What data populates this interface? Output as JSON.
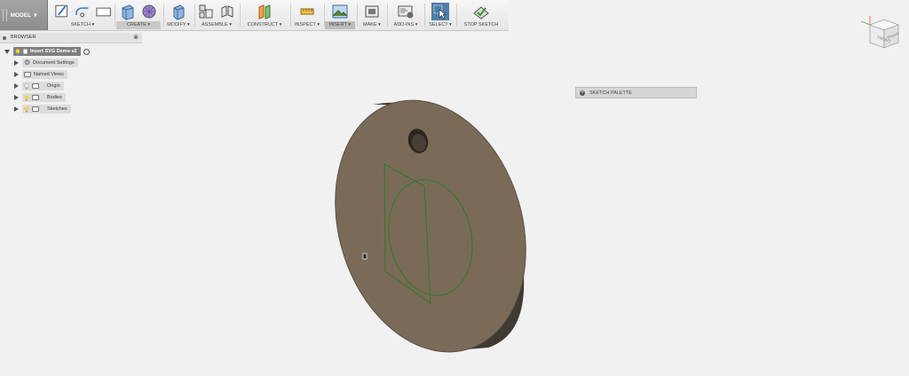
{
  "toolbar": {
    "workspace": "MODEL",
    "groups": [
      {
        "label": "SKETCH ▾"
      },
      {
        "label": "CREATE ▾"
      },
      {
        "label": "MODIFY ▾"
      },
      {
        "label": "ASSEMBLE ▾"
      },
      {
        "label": "CONSTRUCT ▾"
      },
      {
        "label": "INSPECT ▾"
      },
      {
        "label": "INSERT ▾"
      },
      {
        "label": "MAKE ▾"
      },
      {
        "label": "ADD-INS ▾"
      },
      {
        "label": "SELECT ▾"
      },
      {
        "label": "STOP SKETCH"
      }
    ]
  },
  "browser": {
    "title": "BROWSER",
    "items": [
      {
        "label": "Insert SVG Demo v2",
        "icon": "lightbulb-icon"
      },
      {
        "label": "Document Settings",
        "icon": "gear-icon"
      },
      {
        "label": "Named Views",
        "icon": "folder-icon"
      },
      {
        "label": "Origin",
        "icon": "folder-icon"
      },
      {
        "label": "Bodies",
        "icon": "folder-icon"
      },
      {
        "label": "Sketches",
        "icon": "folder-icon"
      }
    ]
  },
  "sketch_palette": {
    "title": "SKETCH PALETTE"
  },
  "viewcube": {
    "faces": [
      "FRONT",
      "RIGHT"
    ]
  },
  "colors": {
    "part_face": "#7a6b59",
    "part_edge": "#3f3a33",
    "sketch_line": "#2f7a24",
    "select_active": "#4d7fa8"
  }
}
